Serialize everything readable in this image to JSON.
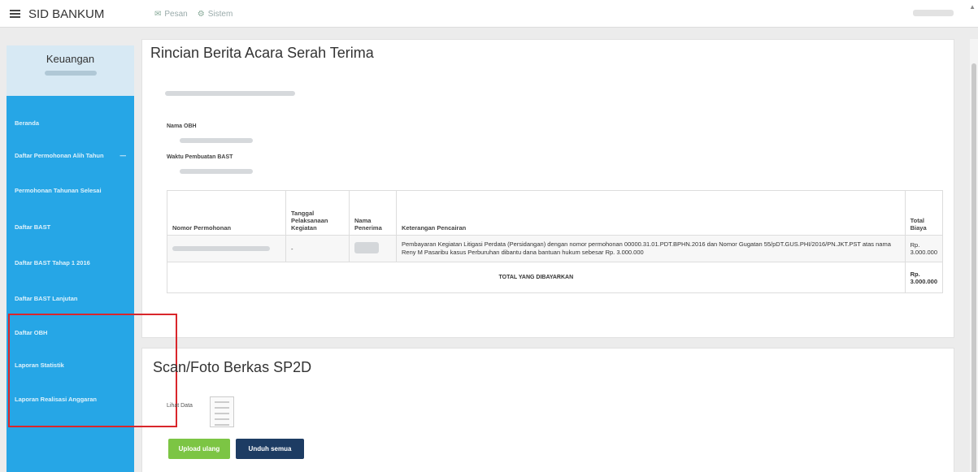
{
  "app": {
    "brand": "SID BANKUM"
  },
  "topnav": {
    "items": [
      {
        "icon": "✉",
        "label": "Pesan"
      },
      {
        "icon": "⚙",
        "label": "Sistem"
      }
    ]
  },
  "sidebar": {
    "header_title": "Keuangan",
    "items": [
      {
        "label": "Beranda"
      },
      {
        "label": "Daftar Permohonan Alih Tahun",
        "has_arrow": true
      },
      {
        "label": "Permohonan Tahunan Selesai"
      },
      {
        "label": "Daftar BAST"
      },
      {
        "label": "Daftar BAST Tahap 1 2016"
      },
      {
        "label": "Daftar BAST Lanjutan"
      },
      {
        "label": "Daftar OBH"
      },
      {
        "label": "Laporan Statistik"
      },
      {
        "label": "Laporan Realisasi Anggaran"
      }
    ]
  },
  "detail": {
    "title": "Rincian Berita Acara Serah Terima",
    "fields": [
      {
        "label": "Nama OBH"
      },
      {
        "label": "Waktu Pembuatan BAST"
      }
    ],
    "table": {
      "headers": [
        "Nomor Permohonan",
        "Tanggal Pelaksanaan Kegiatan",
        "Nama Penerima",
        "Keterangan Pencairan",
        "Total Biaya"
      ],
      "row": {
        "tanggal": "-",
        "keterangan": "Pembayaran Kegiatan Litigasi Perdata (Persidangan) dengan nomor permohonan 00000.31.01.PDT.BPHN.2016 dan Nomor Gugatan 55/pDT.GUS.PHI/2016/PN.JKT.PST atas nama Reny M Pasaribu kasus Perburuhan dibantu dana bantuan hukum sebesar Rp. 3.000.000",
        "biaya": "Rp. 3.000.000"
      },
      "total_label": "TOTAL YANG DIBAYARKAN",
      "total_value": "Rp. 3.000.000"
    }
  },
  "scan": {
    "title": "Scan/Foto Berkas SP2D",
    "lihat_label": "Lihat Data",
    "upload_button": "Upload ulang",
    "download_button": "Unduh semua"
  }
}
